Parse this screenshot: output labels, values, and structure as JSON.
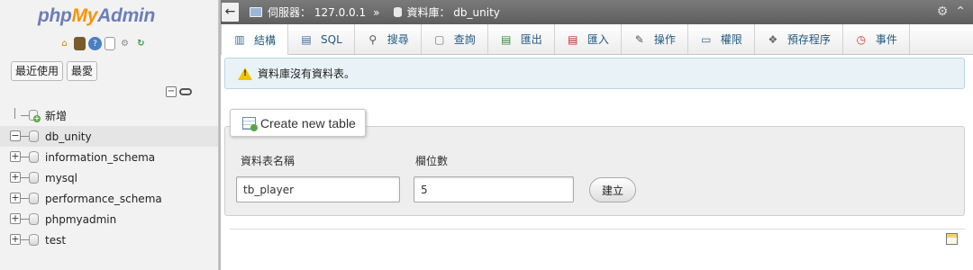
{
  "logo": {
    "part1": "php",
    "part2": "My",
    "part3": "Admin"
  },
  "sidebar": {
    "quick_icons": [
      "home-icon",
      "exit-icon",
      "help-icon",
      "docs-icon",
      "settings-icon",
      "reload-icon"
    ],
    "recent_label": "最近使用",
    "favorites_label": "最愛",
    "collapse_all": "−",
    "tree": [
      {
        "label": "新增",
        "type": "new"
      },
      {
        "label": "db_unity",
        "type": "db",
        "expander": "−",
        "active": true
      },
      {
        "label": "information_schema",
        "type": "db",
        "expander": "+"
      },
      {
        "label": "mysql",
        "type": "db",
        "expander": "+"
      },
      {
        "label": "performance_schema",
        "type": "db",
        "expander": "+"
      },
      {
        "label": "phpmyadmin",
        "type": "db",
        "expander": "+"
      },
      {
        "label": "test",
        "type": "db",
        "expander": "+"
      }
    ]
  },
  "breadcrumb": {
    "back": "←",
    "server_label": "伺服器：",
    "server_value": "127.0.0.1",
    "separator": "»",
    "db_label": "資料庫：",
    "db_value": "db_unity"
  },
  "tabs": [
    {
      "label": "結構",
      "icon": "structure-icon",
      "glyph": "▥",
      "color": "#3a6a9a",
      "active": true
    },
    {
      "label": "SQL",
      "icon": "sql-icon",
      "glyph": "▤",
      "color": "#3a6a9a"
    },
    {
      "label": "搜尋",
      "icon": "search-icon",
      "glyph": "🔍",
      "color": "#555"
    },
    {
      "label": "查詢",
      "icon": "query-icon",
      "glyph": "▢",
      "color": "#777"
    },
    {
      "label": "匯出",
      "icon": "export-icon",
      "glyph": "▤",
      "color": "#3a8a3a"
    },
    {
      "label": "匯入",
      "icon": "import-icon",
      "glyph": "▤",
      "color": "#b03030"
    },
    {
      "label": "操作",
      "icon": "wrench-icon",
      "glyph": "🔧",
      "color": "#555"
    },
    {
      "label": "權限",
      "icon": "privileges-icon",
      "glyph": "▭",
      "color": "#3a6a9a"
    },
    {
      "label": "預存程序",
      "icon": "routines-icon",
      "glyph": "❖",
      "color": "#666"
    },
    {
      "label": "事件",
      "icon": "clock-icon",
      "glyph": "◷",
      "color": "#c0392b"
    }
  ],
  "notice": {
    "text": "資料庫沒有資料表。"
  },
  "create_table": {
    "legend": "Create new table",
    "name_label": "資料表名稱",
    "name_value": "tb_player",
    "cols_label": "欄位數",
    "cols_value": "5",
    "button": "建立"
  },
  "colors": {
    "logo_blue": "#6c7eb7",
    "logo_orange": "#f89406",
    "tab_text": "#235a81",
    "topbar": "#6b6b6b"
  }
}
